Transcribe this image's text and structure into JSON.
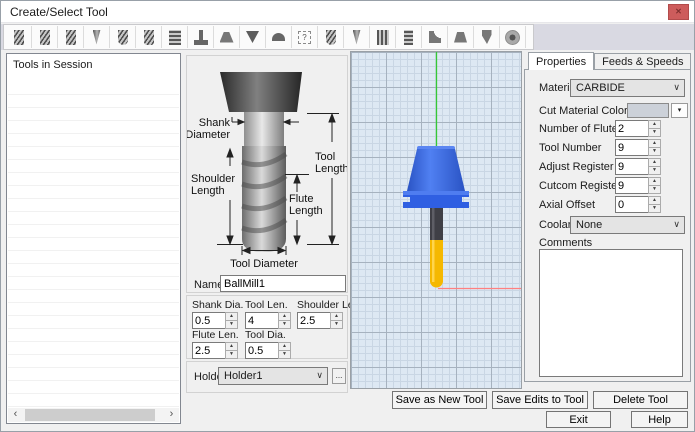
{
  "window": {
    "title": "Create/Select Tool"
  },
  "toolbar": {
    "tools": [
      "rough-endmill",
      "flat-endmill",
      "center-cutting-endmill",
      "drill",
      "ballnose-endmill",
      "bullnose-endmill",
      "thread-mill",
      "t-slot-cutter",
      "chamfer-mill",
      "spot-drill",
      "radius-mill",
      "custom-tool",
      "tapered-ballnose",
      "countersink",
      "reamer",
      "tap",
      "corner-rounding",
      "dovetail-mill",
      "engraver",
      "face-mill"
    ]
  },
  "session_list": {
    "header": "Tools in Session"
  },
  "diagram": {
    "labels": {
      "shank_diameter": [
        "Shank",
        "Diameter"
      ],
      "tool_length": [
        "Tool",
        "Length"
      ],
      "shoulder_length": [
        "Shoulder",
        "Length"
      ],
      "flute_length": [
        "Flute",
        "Length"
      ],
      "tool_diameter": "Tool Diameter"
    }
  },
  "form": {
    "name_label": "Name",
    "name_value": "BallMill1",
    "fields": [
      {
        "label": "Shank Dia.",
        "value": "0.5"
      },
      {
        "label": "Tool Len.",
        "value": "4"
      },
      {
        "label": "Shoulder Len.",
        "value": "2.5"
      },
      {
        "label": "Flute Len.",
        "value": "2.5"
      },
      {
        "label": "Tool Dia.",
        "value": "0.5"
      }
    ],
    "holder_label": "Holder",
    "holder_value": "Holder1",
    "browse_label": "..."
  },
  "properties": {
    "tabs": [
      "Properties",
      "Feeds & Speeds"
    ],
    "material_label": "Material",
    "material_value": "CARBIDE",
    "color_label": "Cut Material Color",
    "spin_rows": [
      {
        "label": "Number of Flutes",
        "value": "2"
      },
      {
        "label": "Tool Number",
        "value": "9"
      },
      {
        "label": "Adjust Register",
        "value": "9"
      },
      {
        "label": "Cutcom Register",
        "value": "9"
      },
      {
        "label": "Axial Offset",
        "value": "0"
      }
    ],
    "coolant_label": "Coolant",
    "coolant_value": "None",
    "comments_label": "Comments",
    "comments_value": ""
  },
  "buttons": {
    "save_new": "Save as New Tool",
    "save_edits": "Save Edits to Tool",
    "delete": "Delete Tool",
    "exit": "Exit",
    "help": "Help"
  },
  "colors": {
    "holder_blue": "#2f5fe2",
    "tool_yellow": "#f5b800",
    "axis_green": "#35c835",
    "axis_red": "#ff8080",
    "grid_background": "#dde8f3",
    "close_button_red": "#cd5c5c",
    "cut_material_swatch": "#ccd1d9"
  }
}
